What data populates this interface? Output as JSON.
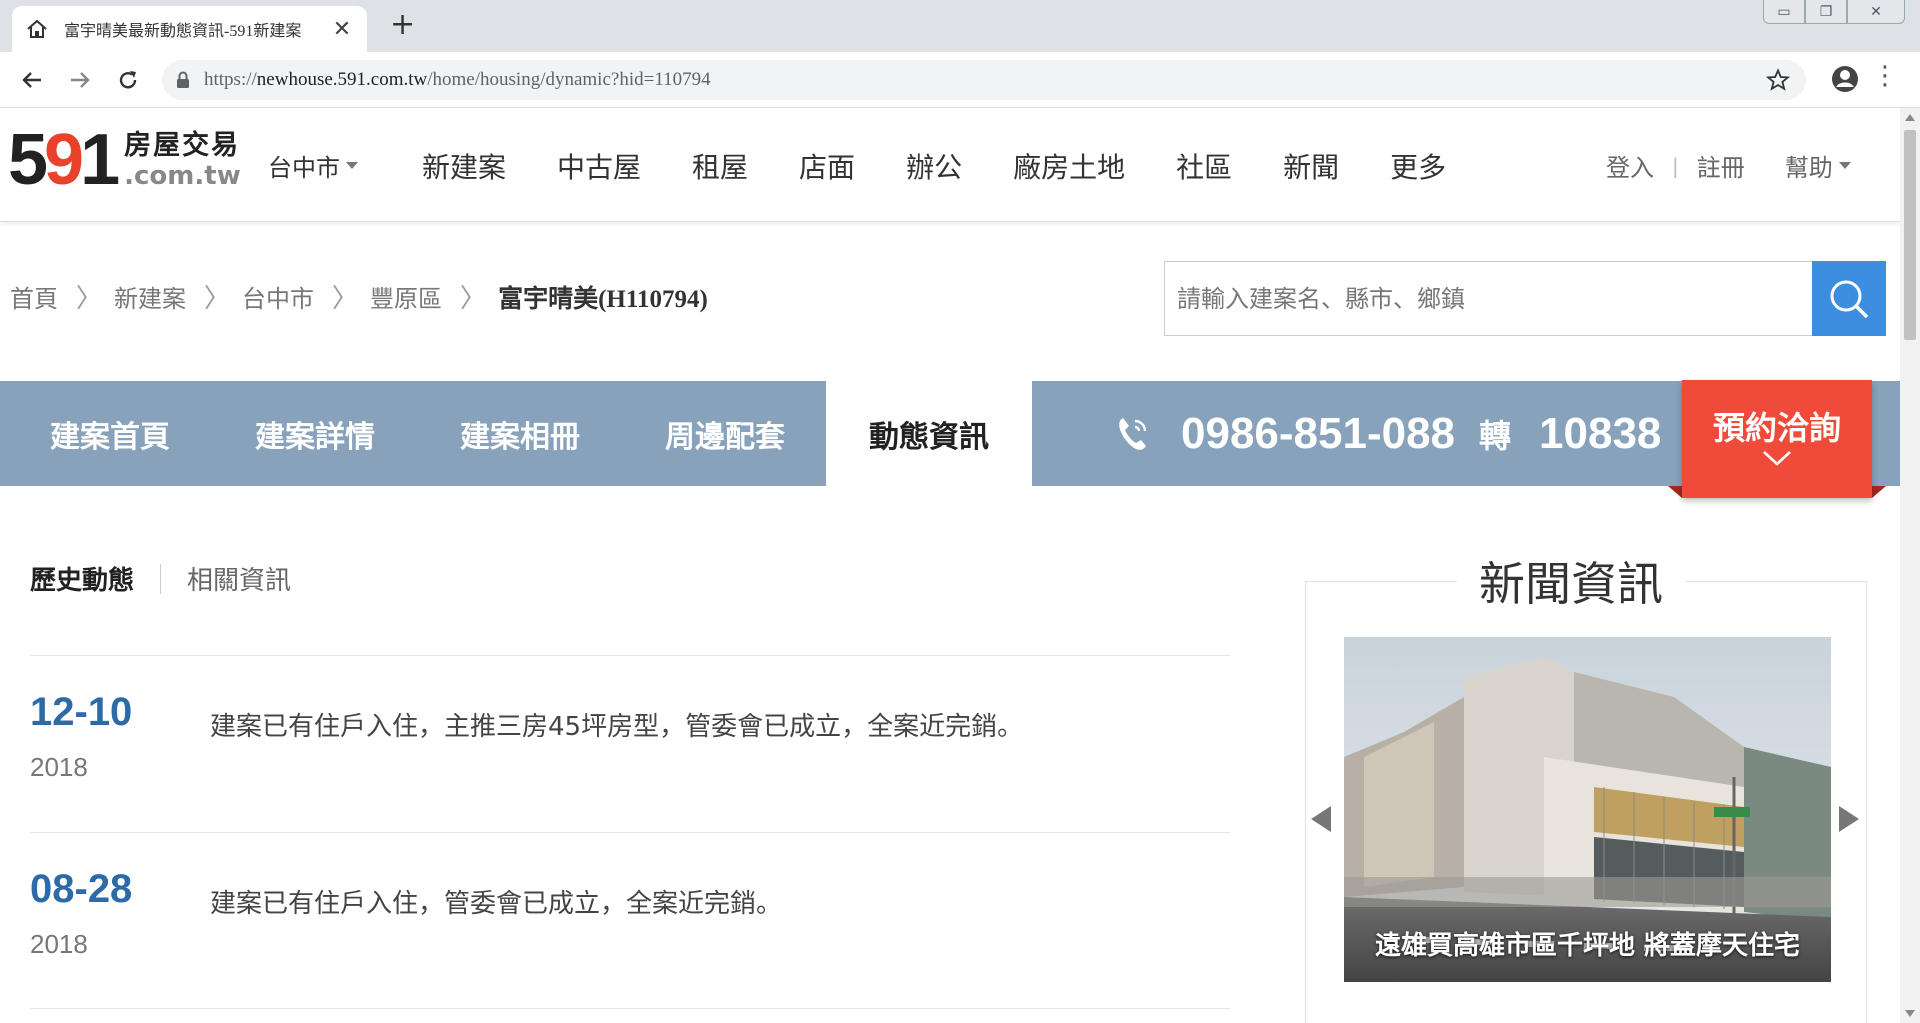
{
  "browser": {
    "tab_title": "富宇晴美最新動態資訊-591新建案",
    "tab_close": "✕",
    "new_tab": "+",
    "url_prefix": "https://",
    "url_host": "newhouse.591.com.tw",
    "url_path": "/home/housing/dynamic?hid=110794",
    "window_controls": [
      "▭",
      "❐",
      "✕"
    ],
    "menu_glyph": "⋮"
  },
  "header": {
    "logo_5": "5",
    "logo_9": "9",
    "logo_1": "1",
    "logo_cn": "房屋交易",
    "logo_en": ".com.tw",
    "city": "台中市",
    "nav": [
      "新建案",
      "中古屋",
      "租屋",
      "店面",
      "辦公",
      "廠房土地",
      "社區",
      "新聞",
      "更多"
    ],
    "login": "登入",
    "register": "註冊",
    "help": "幫助",
    "separator": "|"
  },
  "breadcrumb": {
    "items": [
      "首頁",
      "新建案",
      "台中市",
      "豐原區"
    ],
    "current": "富宇晴美(H110794)",
    "arrow": "〉"
  },
  "search": {
    "placeholder": "請輸入建案名、縣市、鄉鎮"
  },
  "project_nav": {
    "tabs": [
      "建案首頁",
      "建案詳情",
      "建案相冊",
      "周邊配套",
      "動態資訊"
    ],
    "active_index": 4,
    "phone": "0986-851-088",
    "ext_label": "轉",
    "ext": "10838",
    "reserve_label": "預約洽詢",
    "bg_color": "#87a2ba",
    "reserve_color": "#f04a3a"
  },
  "sub_tabs": {
    "active": "歷史動態",
    "other": "相關資訊"
  },
  "timeline": [
    {
      "date": "12-10",
      "year": "2018",
      "text": "建案已有住戶入住，主推三房45坪房型，管委會已成立，全案近完銷。"
    },
    {
      "date": "08-28",
      "year": "2018",
      "text": "建案已有住戶入住，管委會已成立，全案近完銷。"
    }
  ],
  "news": {
    "title": "新聞資訊",
    "caption": "遠雄買高雄市區千坪地 將蓋摩天住宅"
  }
}
